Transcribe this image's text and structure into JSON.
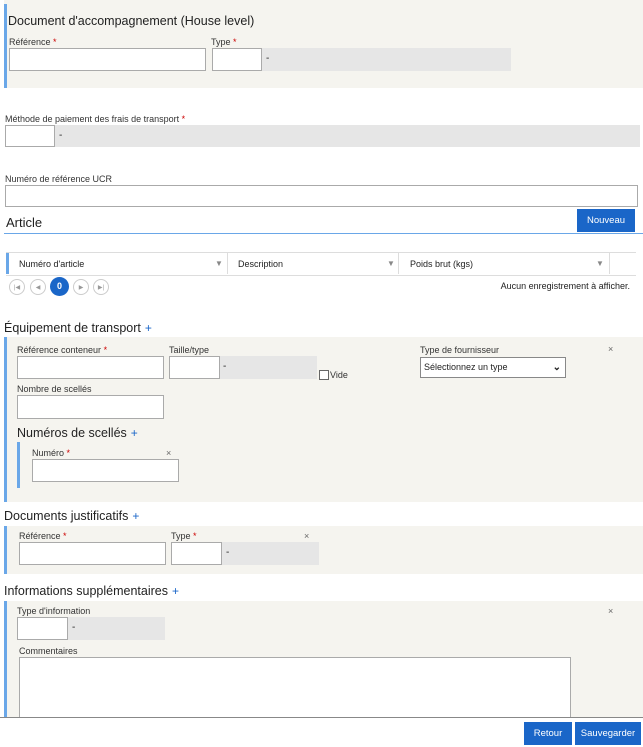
{
  "doc_accompagnement": {
    "title": "Document d'accompagnement (House level)",
    "reference_label": "Référence",
    "type_label": "Type",
    "type_dash": "-"
  },
  "paiement": {
    "label": "Méthode de paiement des frais de transport",
    "dash": "-"
  },
  "ucr": {
    "label": "Numéro de référence UCR"
  },
  "article": {
    "title": "Article",
    "new_button": "Nouveau",
    "columns": [
      "Numéro d'article",
      "Description",
      "Poids brut (kgs)"
    ],
    "current_page": "0",
    "empty_message": "Aucun enregistrement à afficher."
  },
  "equipement": {
    "title": "Équipement de transport",
    "plus": "+",
    "ref_conteneur_label": "Référence conteneur",
    "taille_type_label": "Taille/type",
    "taille_dash": "-",
    "vide_label": "Vide",
    "fournisseur_label": "Type de fournisseur",
    "fournisseur_selected": "Sélectionnez un type",
    "nombre_scelles_label": "Nombre de scellés",
    "close": "×",
    "numeros_scelles": {
      "title": "Numéros de scellés",
      "plus": "+",
      "numero_label": "Numéro",
      "close": "×"
    }
  },
  "justificatifs": {
    "title": "Documents justificatifs",
    "plus": "+",
    "reference_label": "Référence",
    "type_label": "Type",
    "type_dash": "-",
    "close": "×"
  },
  "supplementaires": {
    "title": "Informations supplémentaires",
    "plus": "+",
    "type_info_label": "Type d'information",
    "type_dash": "-",
    "commentaires_label": "Commentaires",
    "close": "×"
  },
  "footer": {
    "retour": "Retour",
    "sauvegarder": "Sauvegarder"
  },
  "required_mark": "*"
}
